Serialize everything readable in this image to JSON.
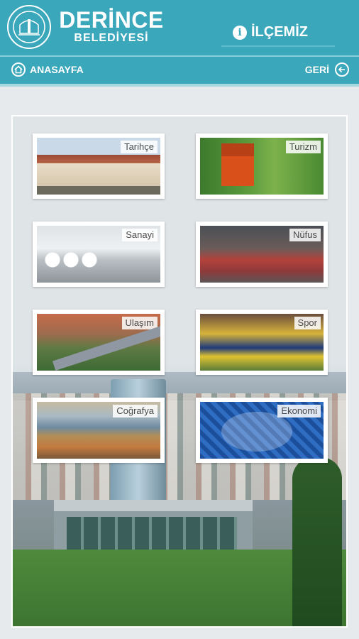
{
  "header": {
    "brand_line1": "DERİNCE",
    "brand_line2": "BELEDİYESİ",
    "section_title": "İLÇEMİZ"
  },
  "nav": {
    "home_label": "ANASAYFA",
    "back_label": "GERİ"
  },
  "tiles": [
    {
      "label": "Tarihçe"
    },
    {
      "label": "Turizm"
    },
    {
      "label": "Sanayi"
    },
    {
      "label": "Nüfus"
    },
    {
      "label": "Ulaşım"
    },
    {
      "label": "Spor"
    },
    {
      "label": "Coğrafya"
    },
    {
      "label": "Ekonomi"
    }
  ],
  "icons": {
    "info": "info-icon",
    "home": "home-icon",
    "back": "arrow-left-icon"
  },
  "colors": {
    "header_bg": "#3aa7bb",
    "text_on_header": "#ffffff"
  }
}
